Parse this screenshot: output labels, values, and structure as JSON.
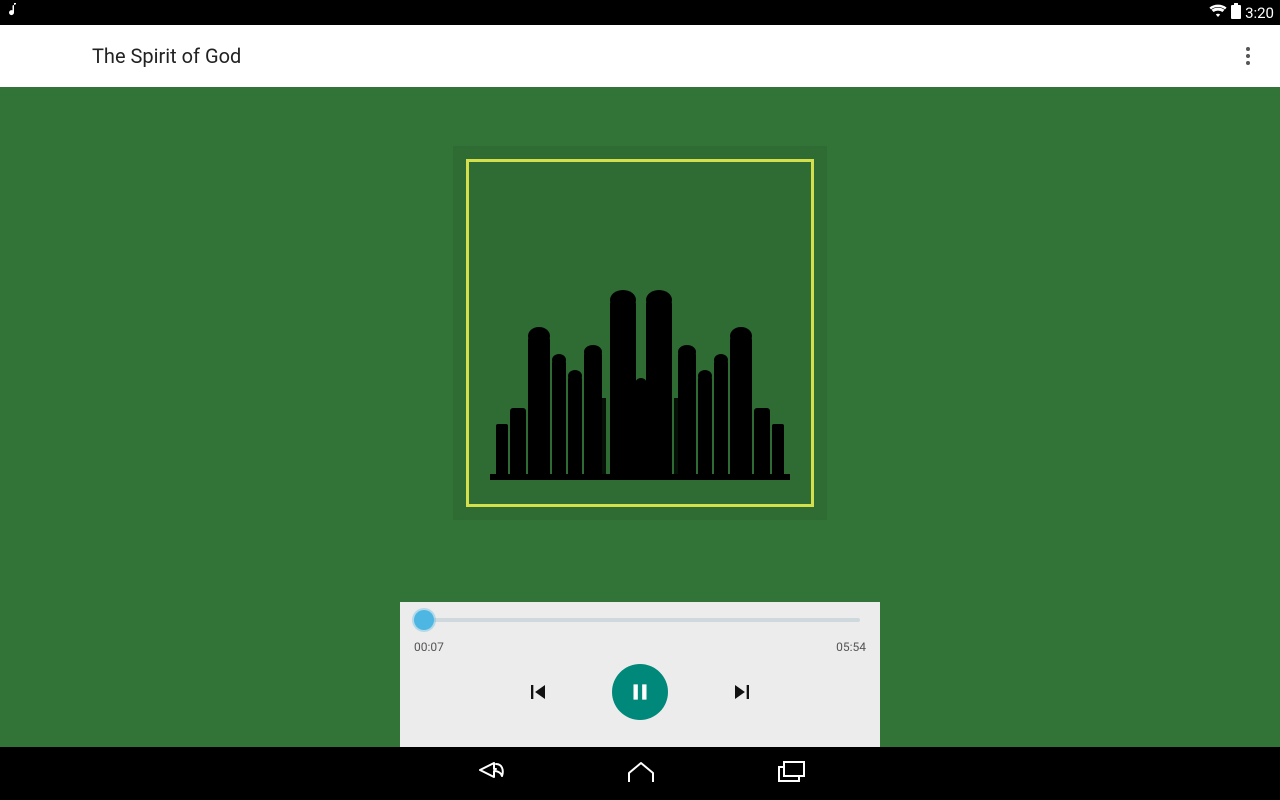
{
  "statusbar": {
    "time": "3:20"
  },
  "appbar": {
    "title": "The Spirit of God"
  },
  "player": {
    "elapsed": "00:07",
    "duration": "05:54"
  },
  "colors": {
    "bg": "#327337",
    "accent": "#00897b",
    "frame": "#d4e04b"
  }
}
